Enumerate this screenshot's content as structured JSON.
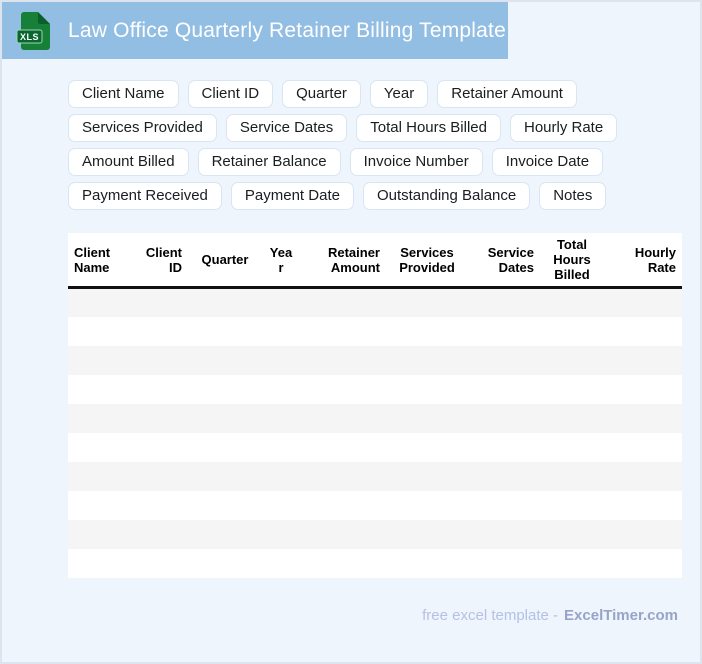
{
  "header": {
    "title": "Law Office Quarterly Retainer Billing Template",
    "file_icon_label": "XLS"
  },
  "chips": [
    "Client Name",
    "Client ID",
    "Quarter",
    "Year",
    "Retainer Amount",
    "Services Provided",
    "Service Dates",
    "Total Hours Billed",
    "Hourly Rate",
    "Amount Billed",
    "Retainer Balance",
    "Invoice Number",
    "Invoice Date",
    "Payment Received",
    "Payment Date",
    "Outstanding Balance",
    "Notes"
  ],
  "table": {
    "columns": [
      {
        "label": "Client Name",
        "align": "left",
        "width": 68
      },
      {
        "label": "Client ID",
        "align": "right",
        "width": 52
      },
      {
        "label": "Quarter",
        "align": "center",
        "width": 74
      },
      {
        "label": "Year",
        "align": "center",
        "width": 38
      },
      {
        "label": "Retainer Amount",
        "align": "right",
        "width": 86
      },
      {
        "label": "Services Provided",
        "align": "center",
        "width": 82
      },
      {
        "label": "Service Dates",
        "align": "right",
        "width": 72
      },
      {
        "label": "Total Hours Billed",
        "align": "center",
        "width": 64
      },
      {
        "label": "Hourly Rate",
        "align": "right",
        "width": 78
      }
    ],
    "row_count": 10,
    "rows": []
  },
  "footer": {
    "prefix": "free excel template -",
    "brand": "ExcelTimer.com"
  },
  "colors": {
    "page-bg": "#eef5fc",
    "frame-border": "#dde4ee",
    "header-bar": "#92bee4",
    "title-text": "#ffffff",
    "chip-bg": "#ffffff",
    "chip-border": "#d8e5f4",
    "chip-text": "#1a1d21",
    "icon-green": "#168039",
    "icon-green-dark": "#0b5f2c",
    "icon-band": "#0a6631",
    "stripe-gray": "#f5f5f6",
    "table-header-bg": "#ffffff",
    "divider-black": "#111111",
    "footer-text-color": "#b6c0e6",
    "footer-brand-color": "#99a3c9"
  }
}
